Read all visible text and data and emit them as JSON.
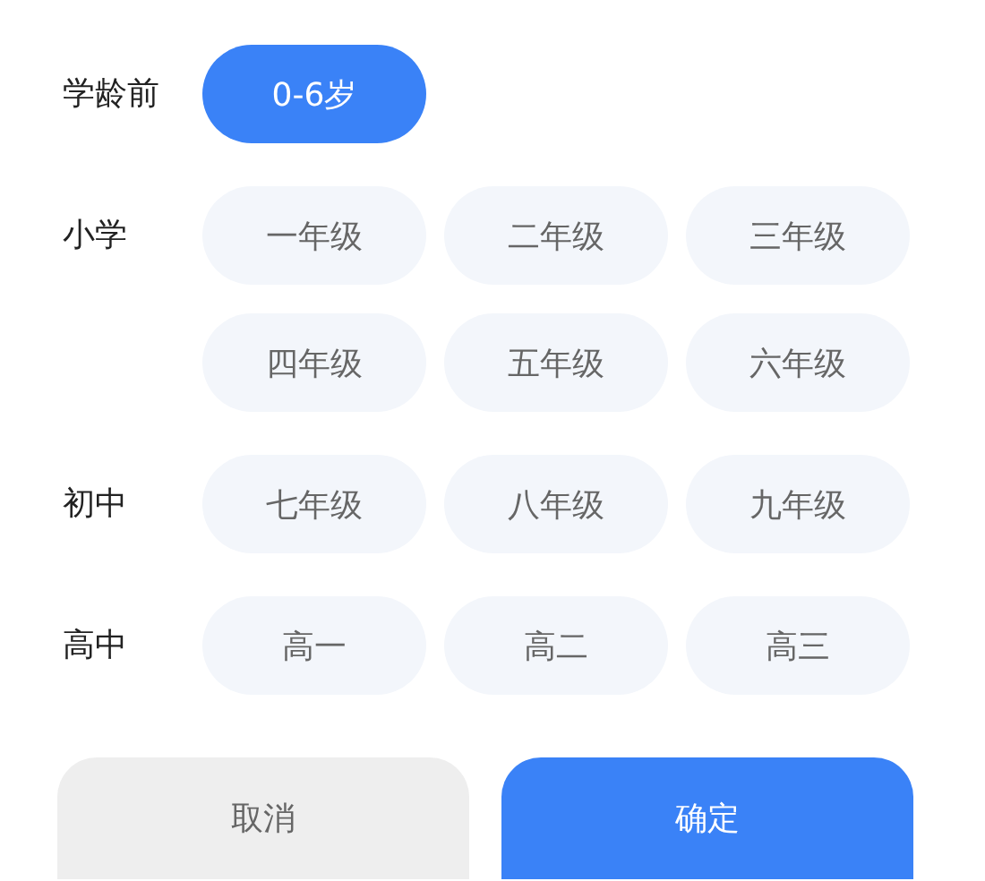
{
  "groups": [
    {
      "label": "学龄前",
      "options": [
        {
          "label": "0-6岁",
          "selected": true
        }
      ]
    },
    {
      "label": "小学",
      "options": [
        {
          "label": "一年级",
          "selected": false
        },
        {
          "label": "二年级",
          "selected": false
        },
        {
          "label": "三年级",
          "selected": false
        },
        {
          "label": "四年级",
          "selected": false
        },
        {
          "label": "五年级",
          "selected": false
        },
        {
          "label": "六年级",
          "selected": false
        }
      ]
    },
    {
      "label": "初中",
      "options": [
        {
          "label": "七年级",
          "selected": false
        },
        {
          "label": "八年级",
          "selected": false
        },
        {
          "label": "九年级",
          "selected": false
        }
      ]
    },
    {
      "label": "高中",
      "options": [
        {
          "label": "高一",
          "selected": false
        },
        {
          "label": "高二",
          "selected": false
        },
        {
          "label": "高三",
          "selected": false
        }
      ]
    }
  ],
  "buttons": [
    {
      "label": "取消",
      "kind": "secondary"
    },
    {
      "label": "确定",
      "kind": "primary"
    }
  ]
}
